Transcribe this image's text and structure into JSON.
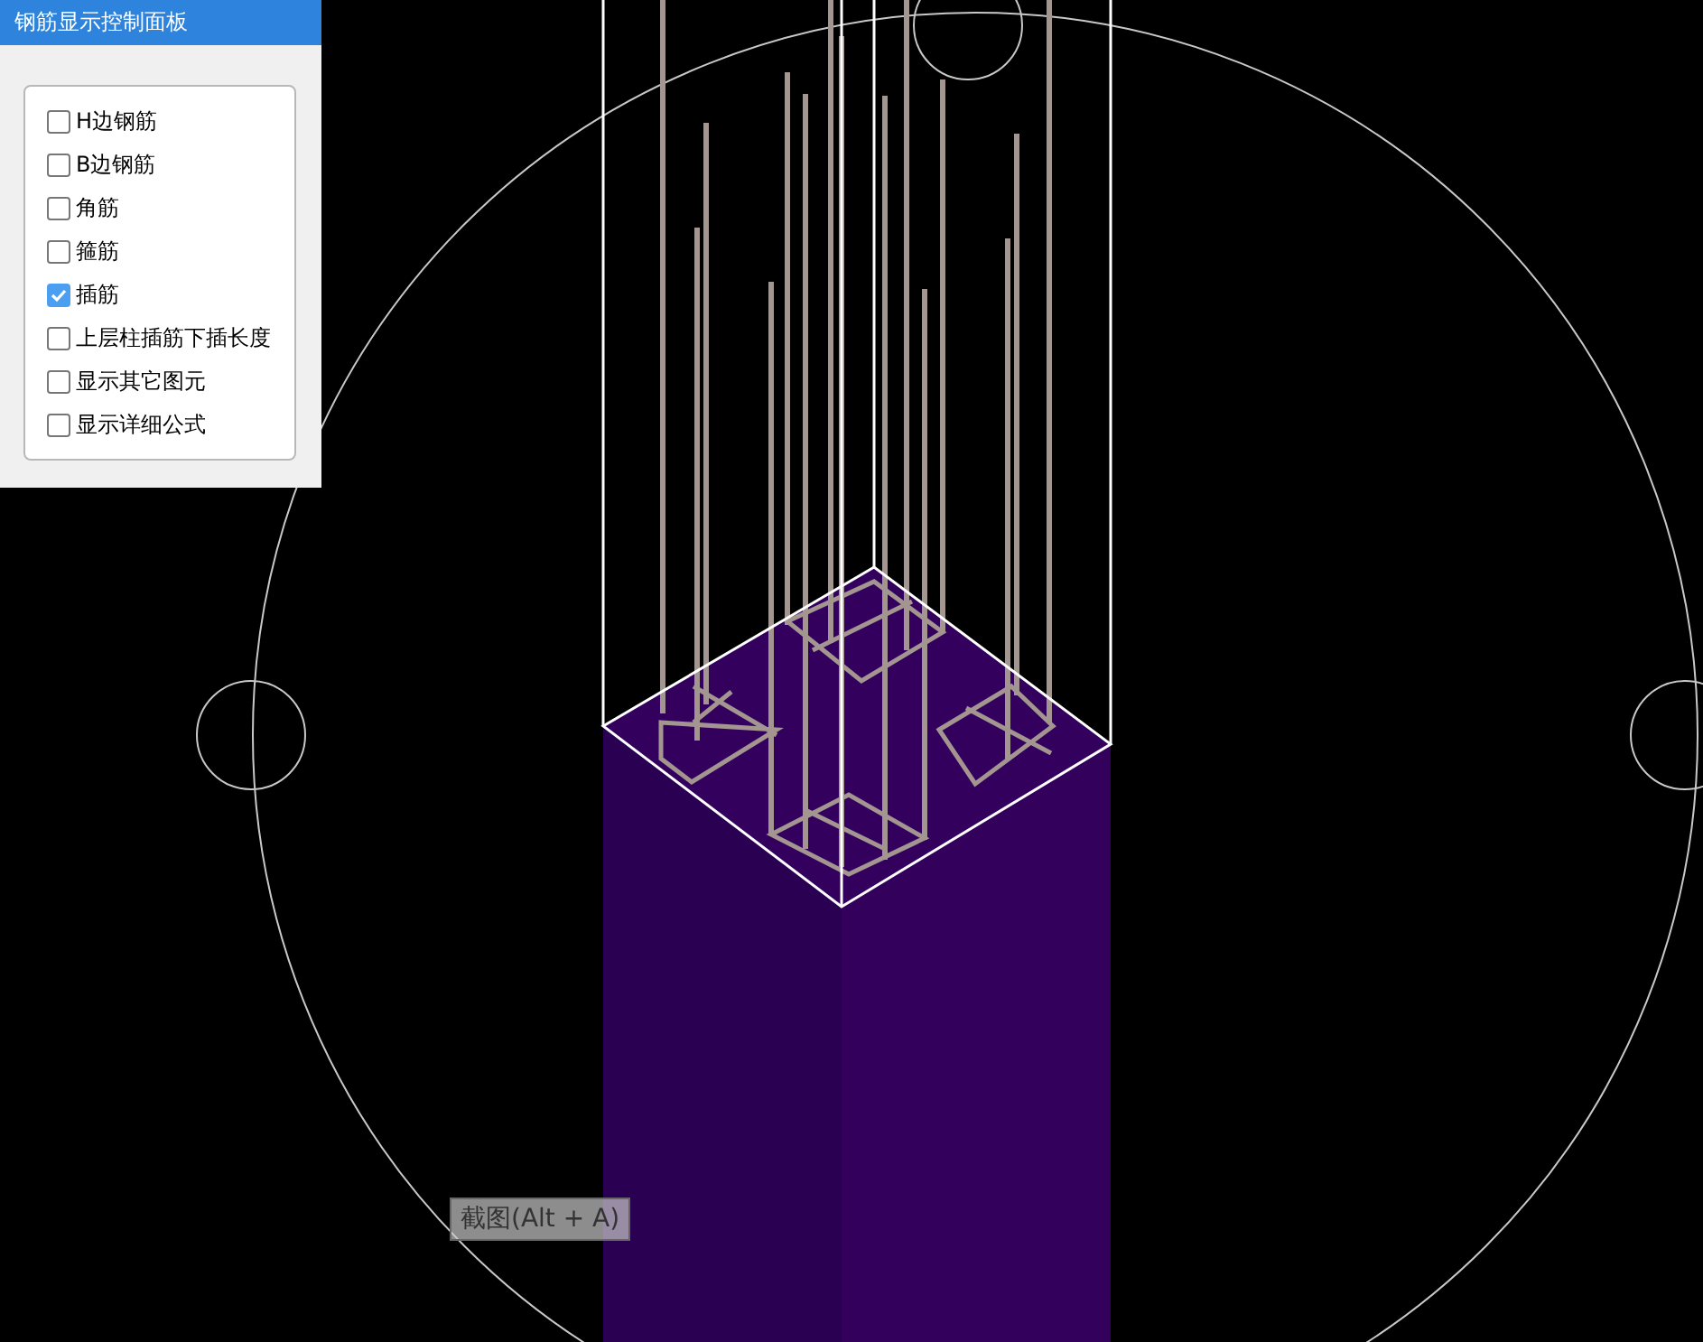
{
  "panel": {
    "title": "钢筋显示控制面板",
    "options": [
      {
        "label": "H边钢筋",
        "checked": false
      },
      {
        "label": "B边钢筋",
        "checked": false
      },
      {
        "label": "角筋",
        "checked": false
      },
      {
        "label": "箍筋",
        "checked": false
      },
      {
        "label": "插筋",
        "checked": true
      },
      {
        "label": "上层柱插筋下插长度",
        "checked": false
      },
      {
        "label": "显示其它图元",
        "checked": false
      },
      {
        "label": "显示详细公式",
        "checked": false
      }
    ]
  },
  "tooltip": {
    "text": "截图(Alt + A)"
  }
}
